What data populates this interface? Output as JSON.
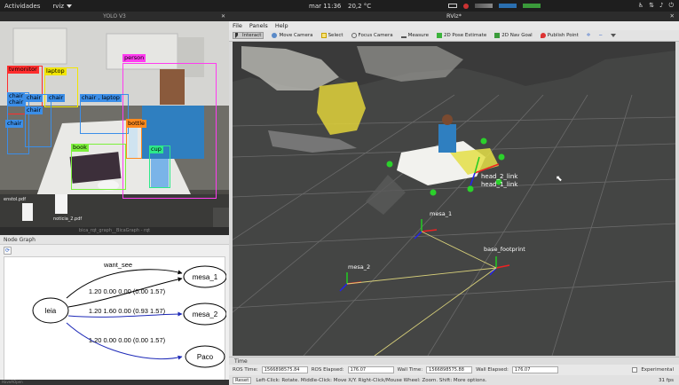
{
  "topbar": {
    "activities": "Actividades",
    "app_name": "rviz",
    "clock": "mar 11:36",
    "weather": "20,2 °C"
  },
  "yolo": {
    "title": "YOLO V3",
    "detections": [
      {
        "label": "tvmonitor",
        "color": "#ff2d2d"
      },
      {
        "label": "laptop",
        "color": "#f2e600"
      },
      {
        "label": "person",
        "color": "#ff3cf0"
      },
      {
        "label": "chair",
        "color": "#3b8ee8"
      },
      {
        "label": "chair",
        "color": "#3b8ee8"
      },
      {
        "label": "chair",
        "color": "#3b8ee8"
      },
      {
        "label": "chair",
        "color": "#3b8ee8"
      },
      {
        "label": "chair",
        "color": "#3b8ee8"
      },
      {
        "label": "chair , laptop",
        "color": "#3b8ee8"
      },
      {
        "label": "chair",
        "color": "#3b8ee8"
      },
      {
        "label": "bottle",
        "color": "#ff8a1e"
      },
      {
        "label": "book",
        "color": "#7cf03c"
      },
      {
        "label": "cup",
        "color": "#2de88a"
      }
    ],
    "file_left": "enstol.pdf",
    "file_right": "noticia_2.pdf",
    "bottom_caption": "bica_rqt_graph__BicaGraph - rqt"
  },
  "nodegraph": {
    "header": "Node Graph",
    "refresh_icon": "refresh-icon",
    "source_node": "leia",
    "nodes": [
      "mesa_1",
      "mesa_2",
      "Paco"
    ],
    "edges": [
      {
        "label": "want_see",
        "to": "mesa_1"
      },
      {
        "label": "1.20 0.00 0.00 (0.00 1.57)",
        "to": "mesa_1"
      },
      {
        "label": "1.20 1.60 0.00 (0.93 1.57)",
        "to": "mesa_2"
      },
      {
        "label": "1.20 0.00 0.00 (0.00 1.57)",
        "to": "Paco"
      }
    ],
    "footer": "HaveAOpen"
  },
  "rviz": {
    "title": "RViz*",
    "menu": [
      "File",
      "Panels",
      "Help"
    ],
    "tools": [
      {
        "label": "Interact",
        "icon": "cursor-icon",
        "active": true
      },
      {
        "label": "Move Camera",
        "icon": "move-camera-icon",
        "active": false
      },
      {
        "label": "Select",
        "icon": "select-icon",
        "active": false
      },
      {
        "label": "Focus Camera",
        "icon": "focus-camera-icon",
        "active": false
      },
      {
        "label": "Measure",
        "icon": "measure-icon",
        "active": false
      },
      {
        "label": "2D Pose Estimate",
        "icon": "pose-estimate-icon",
        "active": false
      },
      {
        "label": "2D Nav Goal",
        "icon": "nav-goal-icon",
        "active": false
      },
      {
        "label": "Publish Point",
        "icon": "publish-point-icon",
        "active": false
      }
    ],
    "frame_labels": {
      "head_2_link": "head_2_link",
      "head_1_link": "head_1_link",
      "mesa_1": "mesa_1",
      "mesa_2": "mesa_2",
      "base_footprint": "base_footprint"
    },
    "time": {
      "header": "Time",
      "ros_time_label": "ROS Time:",
      "ros_time": "1566898575.84",
      "ros_elapsed_label": "ROS Elapsed:",
      "ros_elapsed": "176.07",
      "wall_time_label": "Wall Time:",
      "wall_time": "1566898575.88",
      "wall_elapsed_label": "Wall Elapsed:",
      "wall_elapsed": "176.07",
      "experimental": "Experimental"
    },
    "status": {
      "reset": "Reset",
      "hint": "Left-Click: Rotate. Middle-Click: Move X/Y. Right-Click/Mouse Wheel: Zoom. Shift: More options.",
      "fps": "31 fps"
    }
  }
}
